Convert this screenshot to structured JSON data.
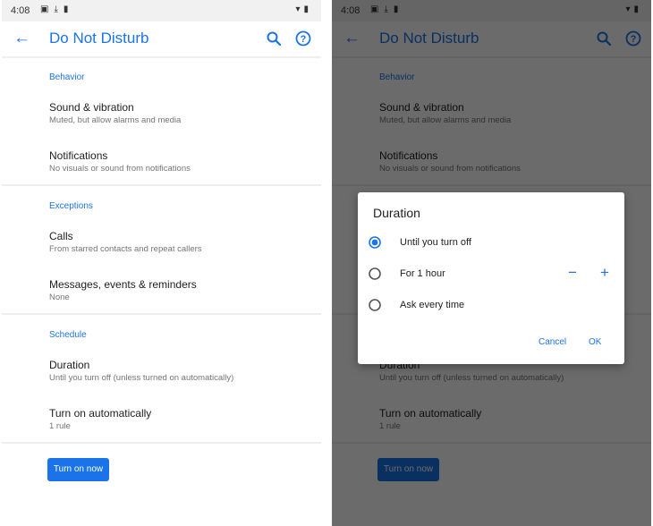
{
  "status": {
    "time": "4:08",
    "left_icons": [
      "gallery-icon",
      "download-icon",
      "battery-saver-icon"
    ],
    "right_icons": [
      "wifi-icon",
      "battery-icon"
    ]
  },
  "appbar": {
    "title": "Do Not Disturb",
    "back_icon": "arrow-back-icon",
    "search_icon": "search-icon",
    "help_icon": "help-icon"
  },
  "sections": {
    "behavior": {
      "header": "Behavior",
      "sound": {
        "title": "Sound & vibration",
        "subtitle": "Muted, but allow alarms and media"
      },
      "notifications": {
        "title": "Notifications",
        "subtitle": "No visuals or sound from notifications"
      }
    },
    "exceptions": {
      "header": "Exceptions",
      "calls": {
        "title": "Calls",
        "subtitle": "From starred contacts and repeat callers"
      },
      "messages": {
        "title": "Messages, events & reminders",
        "subtitle": "None"
      }
    },
    "schedule": {
      "header": "Schedule",
      "duration": {
        "title": "Duration",
        "subtitle": "Until you turn off (unless turned on automatically)"
      },
      "auto": {
        "title": "Turn on automatically",
        "subtitle": "1 rule"
      }
    }
  },
  "button": {
    "turn_on_label": "Turn on now"
  },
  "dialog": {
    "title": "Duration",
    "options": [
      {
        "label": "Until you turn off",
        "selected": true
      },
      {
        "label": "For 1 hour",
        "selected": false
      },
      {
        "label": "Ask every time",
        "selected": false
      }
    ],
    "minus_label": "−",
    "plus_label": "+",
    "cancel_label": "Cancel",
    "ok_label": "OK"
  },
  "colors": {
    "accent": "#1a73e8",
    "scrim": "#000000",
    "status_bar": "#f1f1f1"
  }
}
